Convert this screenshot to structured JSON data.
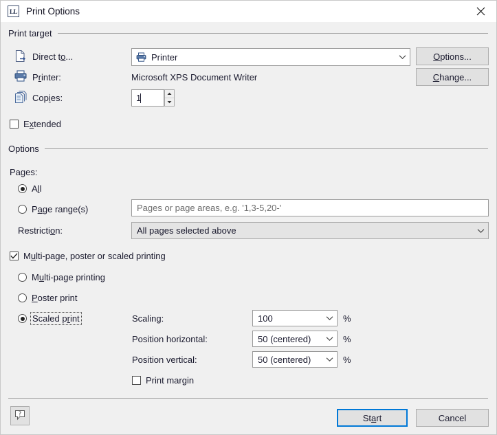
{
  "window": {
    "title": "Print Options",
    "app_icon_text": "LL",
    "close_icon": "close-icon"
  },
  "print_target": {
    "group_label": "Print target",
    "direct_to": {
      "label_pre": "Direct t",
      "label_accel": "o",
      "label_post": "...",
      "icon": "document-export-icon",
      "value": "Printer",
      "value_icon": "printer-icon"
    },
    "printer": {
      "label_pre": "P",
      "label_accel": "r",
      "label_post": "inter:",
      "icon": "printer-icon",
      "value": "Microsoft XPS Document Writer"
    },
    "copies": {
      "label_pre": "Cop",
      "label_accel": "i",
      "label_post": "es:",
      "icon": "copies-stack-icon",
      "value": "1",
      "spinner_up": "spinner-up-icon",
      "spinner_down": "spinner-down-icon"
    },
    "options_button": {
      "accel": "O",
      "rest": "ptions..."
    },
    "change_button": {
      "accel": "C",
      "rest": "hange..."
    },
    "extended": {
      "label_pre": "E",
      "label_accel": "x",
      "label_post": "tended",
      "checked": false
    }
  },
  "options": {
    "group_label": "Options",
    "pages_label": "Pages:",
    "all": {
      "label_pre": "A",
      "label_accel": "l",
      "label_post": "l",
      "selected": true
    },
    "page_ranges": {
      "label_pre": "P",
      "label_accel": "a",
      "label_post": "ge range(s)",
      "selected": false,
      "placeholder": "Pages or page areas, e.g. '1,3-5,20-'"
    },
    "restriction": {
      "label_pre": "Restricti",
      "label_accel": "o",
      "label_post": "n:",
      "value": "All pages selected above"
    },
    "multipage": {
      "label_pre": "M",
      "label_accel": "u",
      "label_post": "lti-page, poster or scaled printing",
      "checked": true
    },
    "multipage_printing": {
      "label_pre": "M",
      "label_accel": "u",
      "label_post": "lti-page printing",
      "selected": false
    },
    "poster_print": {
      "label_pre": "",
      "label_accel": "P",
      "label_post": "oster print",
      "selected": false
    },
    "scaled_print": {
      "label_pre": "Scaled p",
      "label_accel": "r",
      "label_post": "int",
      "selected": true,
      "focused": true
    },
    "scaling": {
      "label": "Scaling:",
      "value": "100",
      "unit": "%"
    },
    "position_horizontal": {
      "label": "Position horizontal:",
      "value": "50 (centered)",
      "unit": "%"
    },
    "position_vertical": {
      "label": "Position vertical:",
      "value": "50 (centered)",
      "unit": "%"
    },
    "print_margin": {
      "label": "Print margin",
      "checked": false
    }
  },
  "footer": {
    "help_icon": "help-question-icon",
    "start_button": {
      "pre": "St",
      "accel": "a",
      "post": "rt"
    },
    "cancel_button": {
      "label": "Cancel"
    }
  },
  "colors": {
    "dialog_bg": "#f0f0f0",
    "accent_focus": "#0078d7",
    "icon_blue": "#3a5a8c",
    "text": "#1a1a2e",
    "placeholder": "#6d6d6d"
  }
}
